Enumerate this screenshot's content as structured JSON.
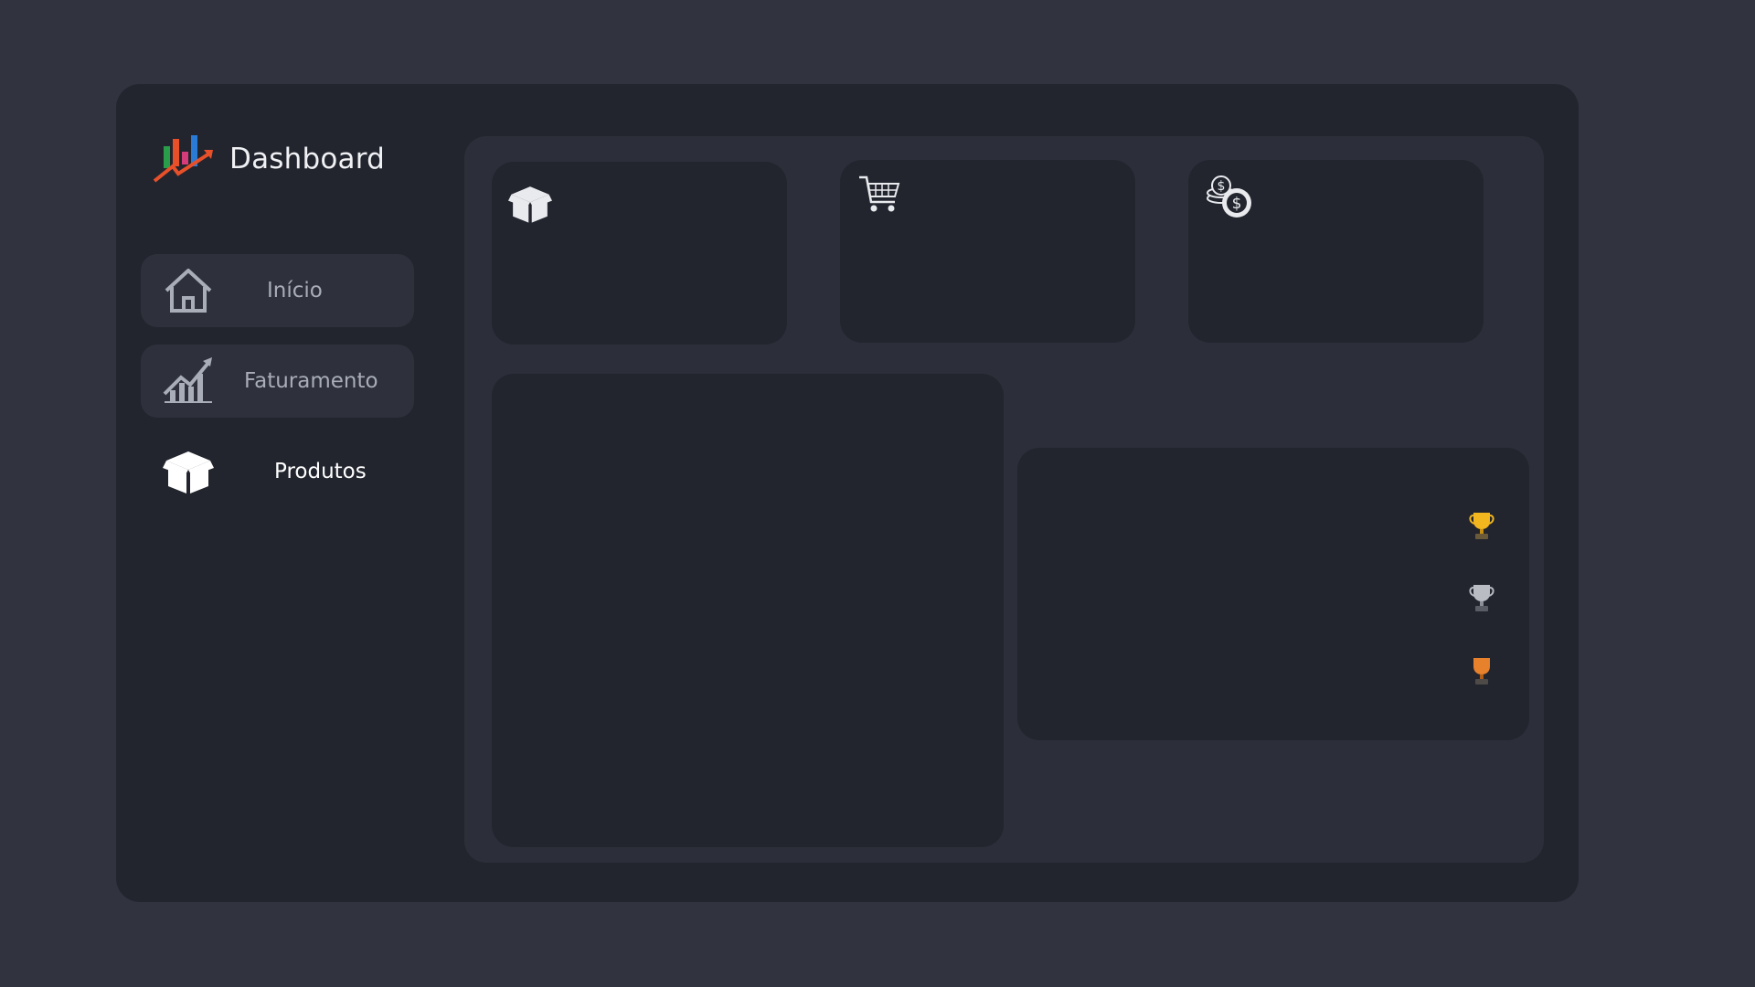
{
  "app": {
    "title": "Dashboard"
  },
  "sidebar": {
    "items": [
      {
        "label": "Início",
        "icon": "home-icon",
        "active": false
      },
      {
        "label": "Faturamento",
        "icon": "growth-chart-icon",
        "active": false
      },
      {
        "label": "Produtos",
        "icon": "box-icon",
        "active": true
      }
    ]
  },
  "main": {
    "kpi_cards": [
      {
        "icon": "box-icon"
      },
      {
        "icon": "shopping-cart-icon"
      },
      {
        "icon": "coins-icon"
      }
    ],
    "ranking": {
      "trophies": [
        {
          "icon": "gold-trophy-icon",
          "color": "#f2b61f"
        },
        {
          "icon": "silver-trophy-icon",
          "color": "#b9bcc3"
        },
        {
          "icon": "bronze-trophy-icon",
          "color": "#e8812c"
        }
      ]
    }
  },
  "colors": {
    "page_background": "#31333f",
    "app_background": "#22252e",
    "panel_background": "#2c2f39",
    "card_background": "#22252e",
    "nav_item_background": "#2e313b",
    "text_primary": "#ffffff",
    "text_muted": "#a9adb8"
  }
}
